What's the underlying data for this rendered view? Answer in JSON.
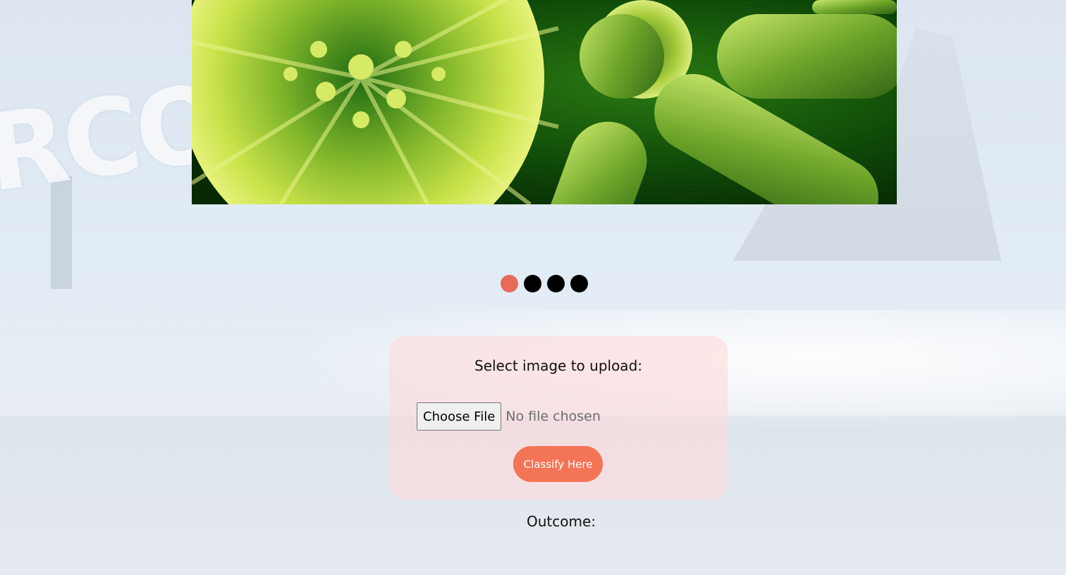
{
  "background": {
    "sign_text": "RCO"
  },
  "hero": {
    "image_name": "bacteria-virus-banner"
  },
  "slider": {
    "dots": [
      {
        "active": true
      },
      {
        "active": false
      },
      {
        "active": false
      },
      {
        "active": false
      }
    ],
    "active_color": "#e86a5a",
    "inactive_color": "#000000"
  },
  "upload": {
    "title": "Select image to upload:",
    "choose_label": "Choose File",
    "no_file_text": "No file chosen",
    "classify_label": "Classify Here",
    "card_color": "#ffdada",
    "button_color": "#f47456"
  },
  "result": {
    "label": "Outcome:"
  }
}
